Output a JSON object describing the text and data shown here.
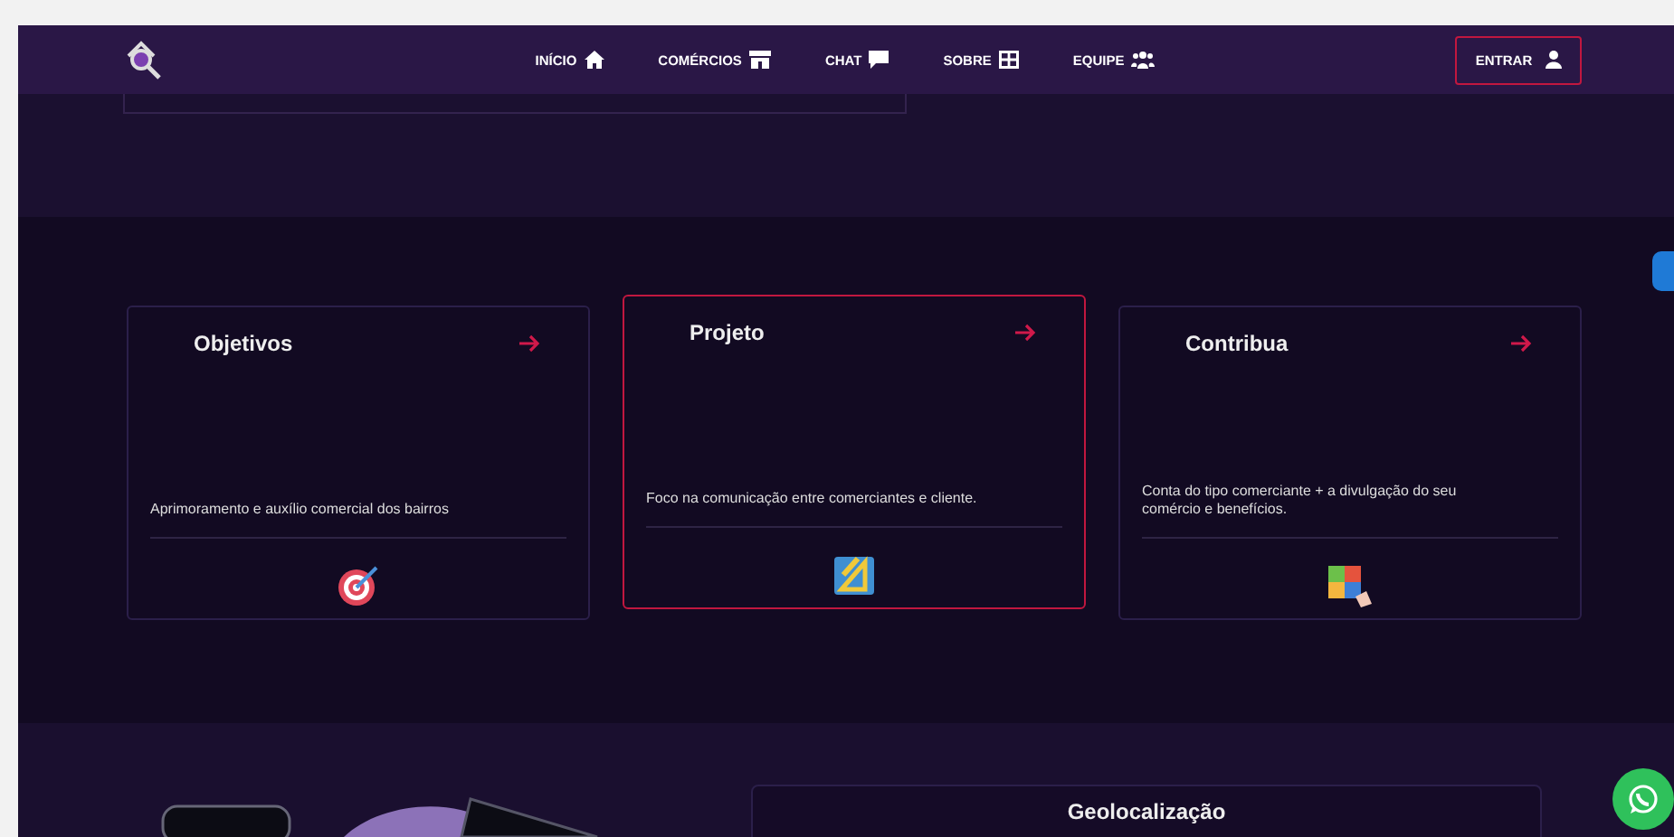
{
  "nav": {
    "items": [
      {
        "label": "INÍCIO"
      },
      {
        "label": "COMÉRCIOS"
      },
      {
        "label": "CHAT"
      },
      {
        "label": "SOBRE"
      },
      {
        "label": "EQUIPE"
      }
    ],
    "login": "ENTRAR"
  },
  "cards": [
    {
      "title": "Objetivos",
      "text": "Aprimoramento e auxílio comercial dos bairros",
      "selected": false
    },
    {
      "title": "Projeto",
      "text": "Foco na comunicação entre comerciantes e cliente.",
      "selected": true
    },
    {
      "title": "Contribua",
      "text": "Conta do tipo comerciante + a divulgação do seu comércio e benefícios.",
      "selected": false
    }
  ],
  "geo": {
    "title": "Geolocalização"
  }
}
